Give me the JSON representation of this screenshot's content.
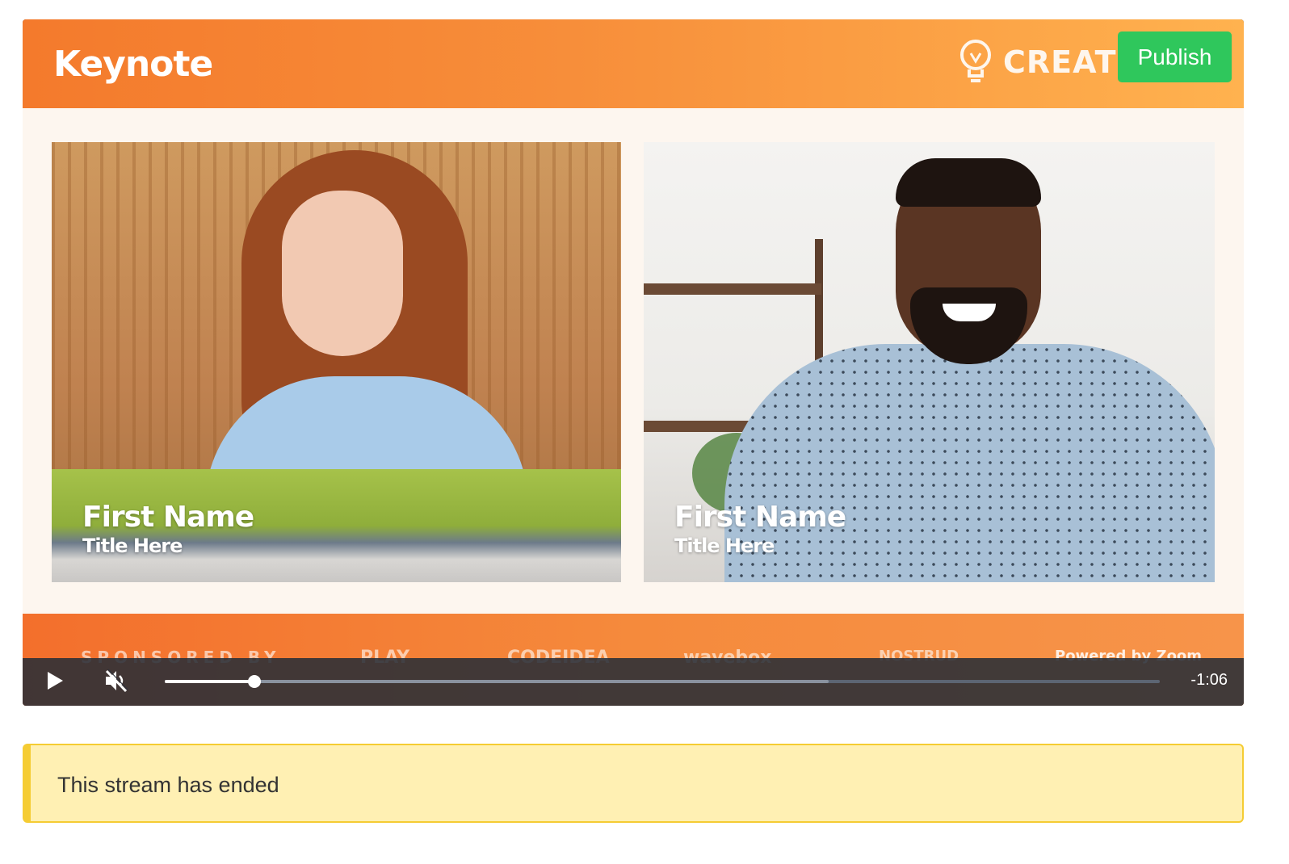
{
  "stream": {
    "slide_title": "Keynote",
    "brand_name": "CREATE",
    "publish_label": "Publish",
    "speakers": [
      {
        "name": "First Name",
        "title": "Title Here"
      },
      {
        "name": "First Name",
        "title": "Title Here"
      }
    ],
    "sponsors": {
      "label": "SPONSORED BY",
      "logos": [
        "PLAY",
        "CODEIDEA",
        "wavebox",
        "NOSTRUD"
      ],
      "powered_by": "Powered by Zoom"
    }
  },
  "player": {
    "time_remaining": "-1:06",
    "progress_fraction": 0.09,
    "buffered_fraction": 0.667,
    "muted": true,
    "play_icon": "play-icon",
    "mute_icon": "muted-speaker-icon"
  },
  "alert": {
    "message": "This stream has ended",
    "color_bg": "#fff0b3",
    "color_border": "#f5cc33"
  },
  "colors": {
    "accent_orange": "#f47a2c",
    "publish_green": "#2fc75c"
  }
}
